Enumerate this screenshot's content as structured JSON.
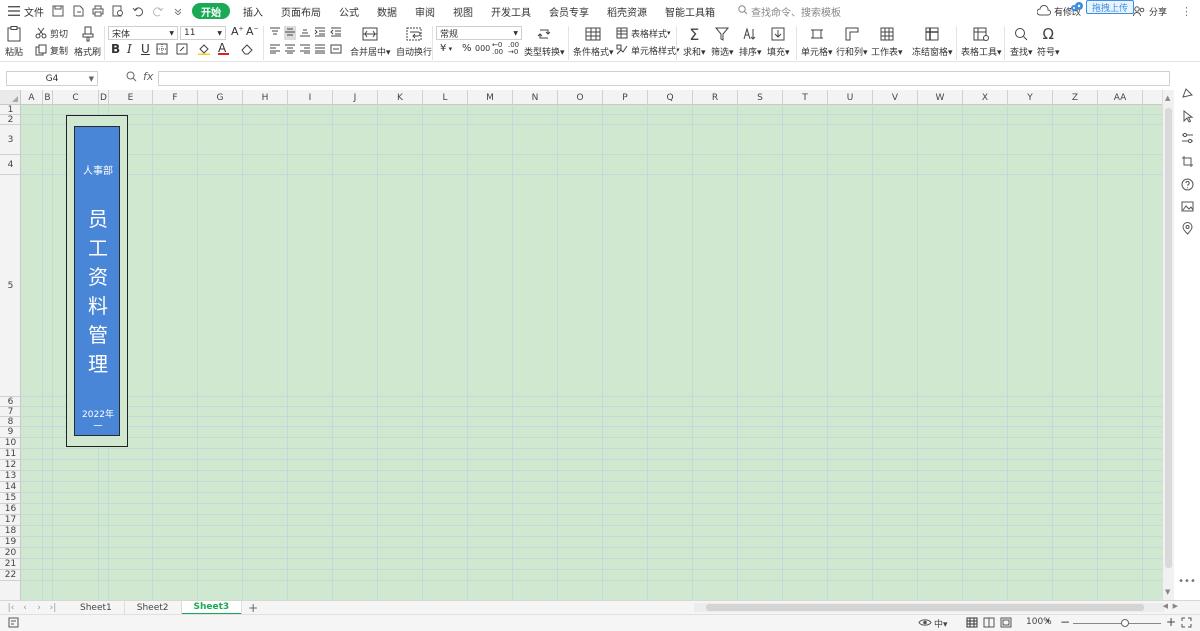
{
  "menubar": {
    "menu_label": "文件",
    "tabs": [
      "开始",
      "插入",
      "页面布局",
      "公式",
      "数据",
      "审阅",
      "视图",
      "开发工具",
      "会员专享",
      "稻壳资源",
      "智能工具箱"
    ],
    "active_tab": "开始",
    "search_placeholder": "查找命令、搜索模板",
    "right_cloud_label": "有修改",
    "upload_label": "拖拽上传",
    "share_label": "分享"
  },
  "ribbon": {
    "paste": "粘贴",
    "cut": "剪切",
    "copy": "复制",
    "format_painter": "格式刷",
    "font_name": "宋体",
    "font_size": "11",
    "bold": "B",
    "italic": "I",
    "underline": "U",
    "merge_center": "合并居中",
    "wrap_text": "自动换行",
    "number_format": "常规",
    "currency": "¥",
    "percent": "%",
    "thousands": "000",
    "type_convert": "类型转换",
    "cond_format": "条件格式",
    "table_style": "表格样式",
    "cell_style": "单元格样式",
    "sum": "求和",
    "filter": "筛选",
    "sort": "排序",
    "fill": "填充",
    "cell": "单元格",
    "row_col": "行和列",
    "worksheet": "工作表",
    "freeze": "冻结窗格",
    "table_tools": "表格工具",
    "find": "查找",
    "symbol": "符号"
  },
  "formula_bar": {
    "name_box": "G4",
    "fx": "fx",
    "content": ""
  },
  "columns": [
    "A",
    "B",
    "C",
    "D",
    "E",
    "F",
    "G",
    "H",
    "I",
    "J",
    "K",
    "L",
    "M",
    "N",
    "O",
    "P",
    "Q",
    "R",
    "S",
    "T",
    "U",
    "V",
    "W",
    "X",
    "Y",
    "Z",
    "AA"
  ],
  "rows": [
    "1",
    "2",
    "3",
    "4",
    "5",
    "6",
    "7",
    "8",
    "9",
    "10",
    "11",
    "12",
    "13",
    "14",
    "15",
    "16",
    "17",
    "18",
    "19",
    "20",
    "21",
    "22"
  ],
  "cover": {
    "department": "人事部",
    "title_chars": [
      "员",
      "工",
      "资",
      "料",
      "管",
      "理"
    ],
    "year": "2022年",
    "dash": "一",
    "card_color": "#4a86d8"
  },
  "sheets": {
    "tabs": [
      "Sheet1",
      "Sheet2",
      "Sheet3"
    ],
    "active": "Sheet3",
    "add": "+"
  },
  "status": {
    "zoom": "100%",
    "zoom_minus": "−",
    "zoom_plus": "+",
    "zoom_level": 0.59
  },
  "colors": {
    "accent": "#1aaa55",
    "sheet_bg": "#cfe8cf",
    "upload_blue": "#3d8fe0"
  }
}
